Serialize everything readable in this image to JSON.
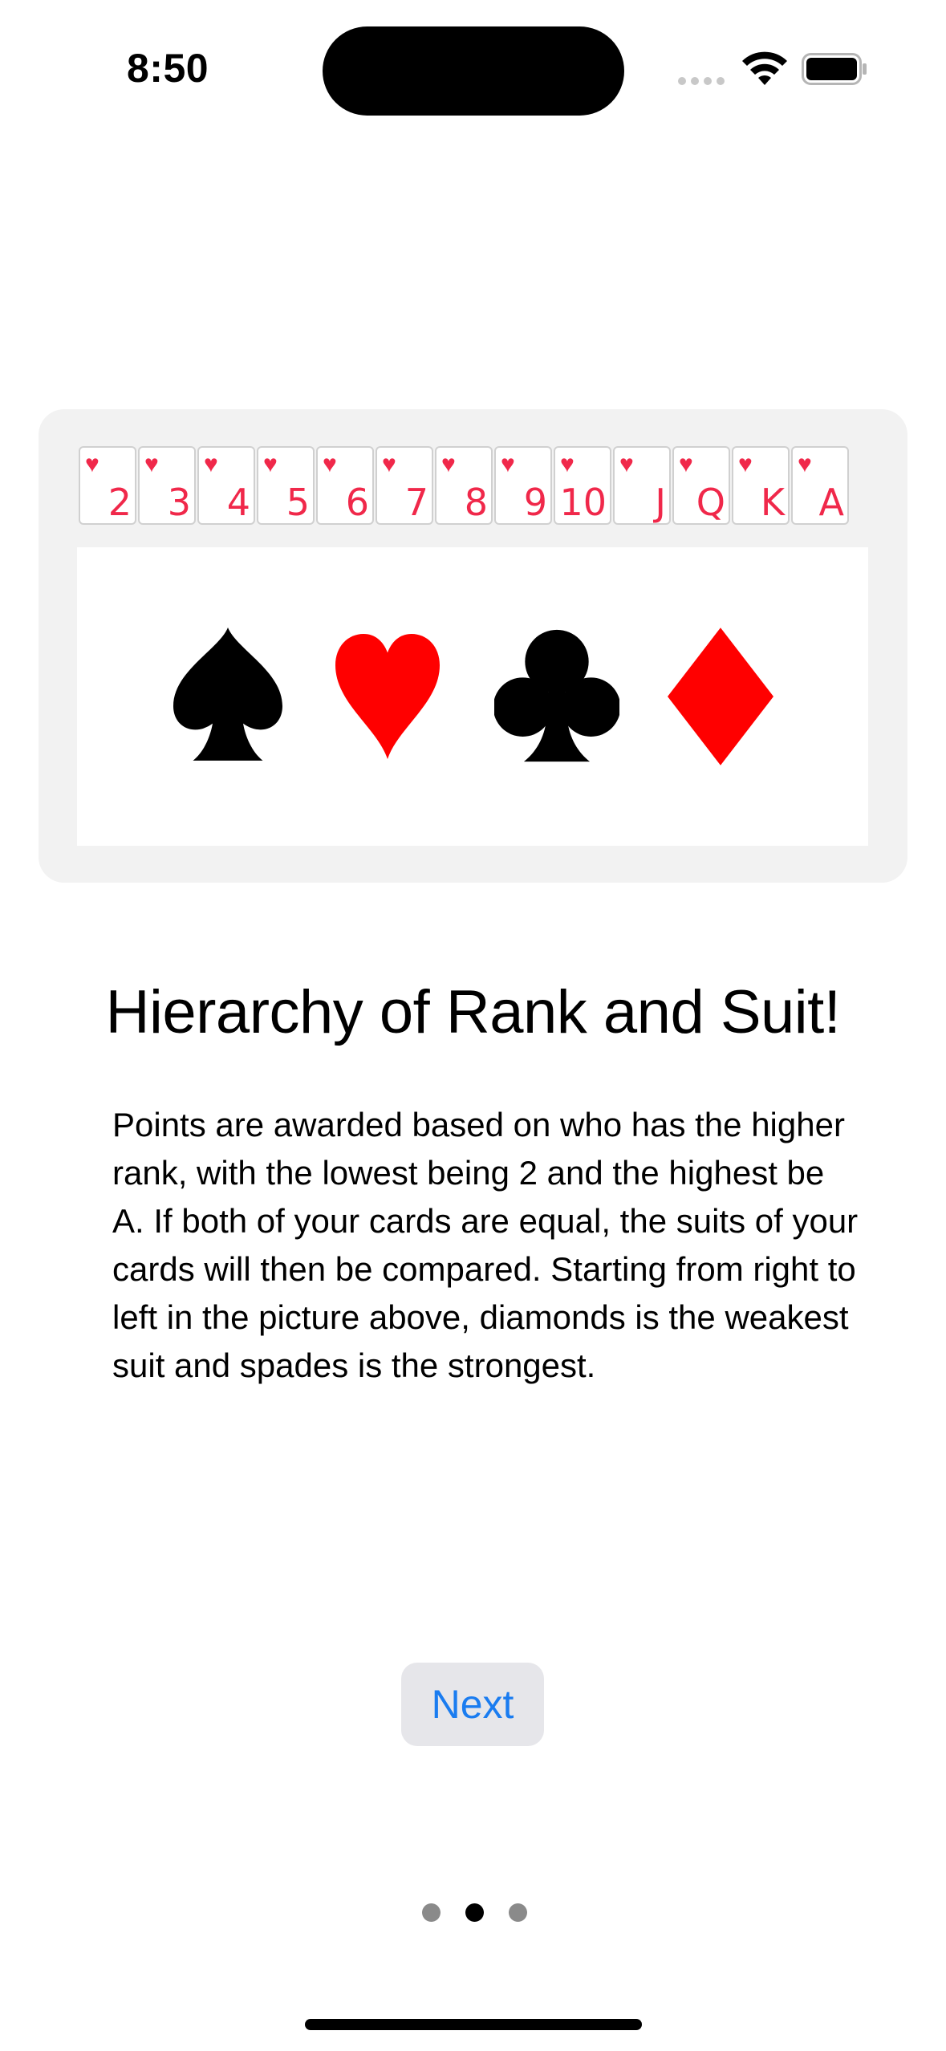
{
  "status_bar": {
    "time": "8:50"
  },
  "illustration": {
    "ranks": [
      "2",
      "3",
      "4",
      "5",
      "6",
      "7",
      "8",
      "9",
      "10",
      "J",
      "Q",
      "K",
      "A"
    ],
    "card_suit_symbol": "♥",
    "suits": [
      {
        "name": "spade",
        "color": "#000000"
      },
      {
        "name": "heart",
        "color": "#ff0000"
      },
      {
        "name": "club",
        "color": "#000000"
      },
      {
        "name": "diamond",
        "color": "#ff0000"
      }
    ]
  },
  "content": {
    "title": "Hierarchy of Rank and Suit!",
    "body": "Points are awarded based on who has the higher rank, with the lowest being 2 and the highest be A. If both of your cards are equal, the suits of your cards will then be compared. Starting from right to left in the picture above, diamonds is the weakest suit and spades is the strongest."
  },
  "actions": {
    "next_label": "Next"
  },
  "pagination": {
    "count": 3,
    "current": 2
  },
  "colors": {
    "accent": "#1a7cf0",
    "card_red": "#f0284a"
  }
}
